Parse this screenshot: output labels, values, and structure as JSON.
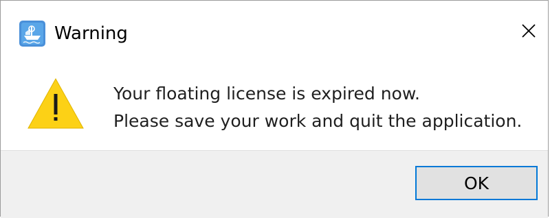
{
  "window": {
    "title": "Warning",
    "icons": {
      "app": "app-logo-icon",
      "close": "close-icon",
      "warning": "warning-triangle-icon"
    }
  },
  "message": {
    "line1": "Your floating license is expired now.",
    "line2": "Please save your work and quit the application."
  },
  "buttons": {
    "ok_label": "OK"
  },
  "colors": {
    "accent": "#0078d7",
    "warning_fill": "#fcd116",
    "footer_bg": "#f0f0f0",
    "button_bg": "#e1e1e1"
  }
}
